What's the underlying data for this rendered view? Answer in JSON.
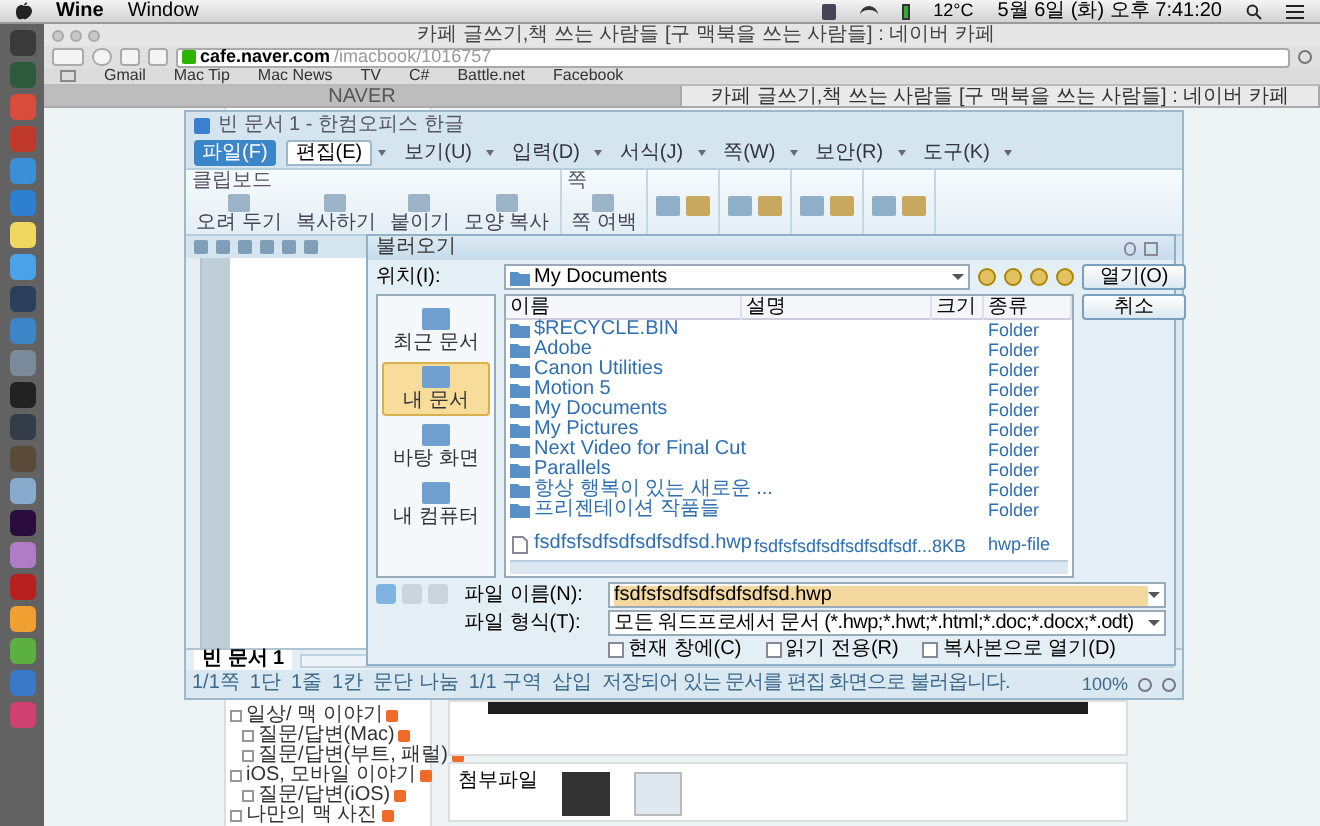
{
  "menubar": {
    "app": "Wine",
    "menus": [
      "Window"
    ],
    "temperature": "12°C",
    "clock": "5월 6일 (화) 오후 7:41:20"
  },
  "browser": {
    "title": "카페 글쓰기,책 쓰는 사람들 [구 맥북을 쓰는 사람들] : 네이버 카페",
    "address_domain": "cafe.naver.com",
    "address_path": "/imacbook/1016757",
    "bookmarks": [
      "Gmail",
      "Mac Tip",
      "Mac News",
      "TV",
      "C#",
      "Battle.net",
      "Facebook"
    ],
    "tabs": [
      {
        "label": "NAVER",
        "selected": false
      },
      {
        "label": "카페 글쓰기,책 쓰는 사람들 [구 맥북을 쓰는 사람들] : 네이버 카페",
        "selected": true
      }
    ]
  },
  "cafe": {
    "menu": [
      {
        "label": "일상/ 맥 이야기",
        "children": [
          {
            "label": "질문/답변(Mac)"
          },
          {
            "label": "질문/답변(부트, 패럴)"
          }
        ]
      },
      {
        "label": "iOS, 모바일 이야기",
        "children": [
          {
            "label": "질문/답변(iOS)"
          }
        ]
      },
      {
        "label": "나만의 맥 사진"
      }
    ],
    "attachments_label": "첨부파일"
  },
  "hwp": {
    "title": "빈 문서 1 - 한컴오피스 한글",
    "menu": [
      {
        "label": "파일(F)",
        "kind": "app",
        "selected": false
      },
      {
        "label": "편집(E)",
        "kind": "tab",
        "selected": true
      },
      {
        "label": "보기(U)",
        "kind": "tab",
        "selected": false
      },
      {
        "label": "입력(D)",
        "kind": "tab",
        "selected": false
      },
      {
        "label": "서식(J)",
        "kind": "tab",
        "selected": false
      },
      {
        "label": "쪽(W)",
        "kind": "tab",
        "selected": false
      },
      {
        "label": "보안(R)",
        "kind": "tab",
        "selected": false
      },
      {
        "label": "도구(K)",
        "kind": "tab",
        "selected": false
      }
    ],
    "ribbon": [
      {
        "label": "클립보드",
        "buttons": [
          "오려 두기",
          "복사하기",
          "붙이기",
          "모양 복사"
        ]
      },
      {
        "label": "쪽",
        "buttons": [
          "쪽 여백"
        ]
      }
    ],
    "document_tab": "빈 문서 1",
    "status": [
      "1/1쪽",
      "1단",
      "1줄",
      "1칸",
      "문단 나눔",
      "1/1 구역",
      "삽입"
    ],
    "status_message": "저장되어 있는 문서를 편집 화면으로 불러옵니다.",
    "zoom": "100%"
  },
  "dialog": {
    "title": "불러오기",
    "location_label": "위치(I):",
    "location": "My Documents",
    "places": [
      {
        "label": "최근 문서",
        "selected": false
      },
      {
        "label": "내 문서",
        "selected": true
      },
      {
        "label": "바탕 화면",
        "selected": false
      },
      {
        "label": "내 컴퓨터",
        "selected": false
      }
    ],
    "columns": [
      "이름",
      "설명",
      "크기",
      "종류"
    ],
    "files": [
      {
        "kind": "folder",
        "name": "$RECYCLE.BIN",
        "type": "Folder"
      },
      {
        "kind": "folder",
        "name": "Adobe",
        "type": "Folder"
      },
      {
        "kind": "folder",
        "name": "Canon Utilities",
        "type": "Folder"
      },
      {
        "kind": "folder",
        "name": "Motion 5",
        "type": "Folder"
      },
      {
        "kind": "folder",
        "name": "My Documents",
        "type": "Folder"
      },
      {
        "kind": "folder",
        "name": "My Pictures",
        "type": "Folder"
      },
      {
        "kind": "folder",
        "name": "Next Video for Final Cut",
        "type": "Folder"
      },
      {
        "kind": "folder",
        "name": "Parallels",
        "type": "Folder"
      },
      {
        "kind": "folder",
        "name": "항상 행복이 있는 새로운 ...",
        "type": "Folder"
      },
      {
        "kind": "folder",
        "name": "프리젠테이션 작품들",
        "type": "Folder"
      },
      {
        "kind": "file",
        "name": "fsdfsfsdfsdfsdfsdfsd.hwp",
        "description": "fsdfsfsdfsdfsdfsdfsdf...",
        "size": "8KB",
        "type": "hwp-file"
      }
    ],
    "file_name_label": "파일 이름(N):",
    "file_name": "fsdfsfsdfsdfsdfsdfsd.hwp",
    "file_type_label": "파일 형식(T):",
    "file_type": "모든 워드프로세서 문서 (*.hwp;*.hwt;*.html;*.doc;*.docx;*.odt)",
    "options": [
      {
        "label": "현재 창에(C)",
        "checked": false
      },
      {
        "label": "읽기 전용(R)",
        "checked": false
      },
      {
        "label": "복사본으로 열기(D)",
        "checked": false
      }
    ],
    "buttons": [
      "열기(O)",
      "취소"
    ]
  }
}
